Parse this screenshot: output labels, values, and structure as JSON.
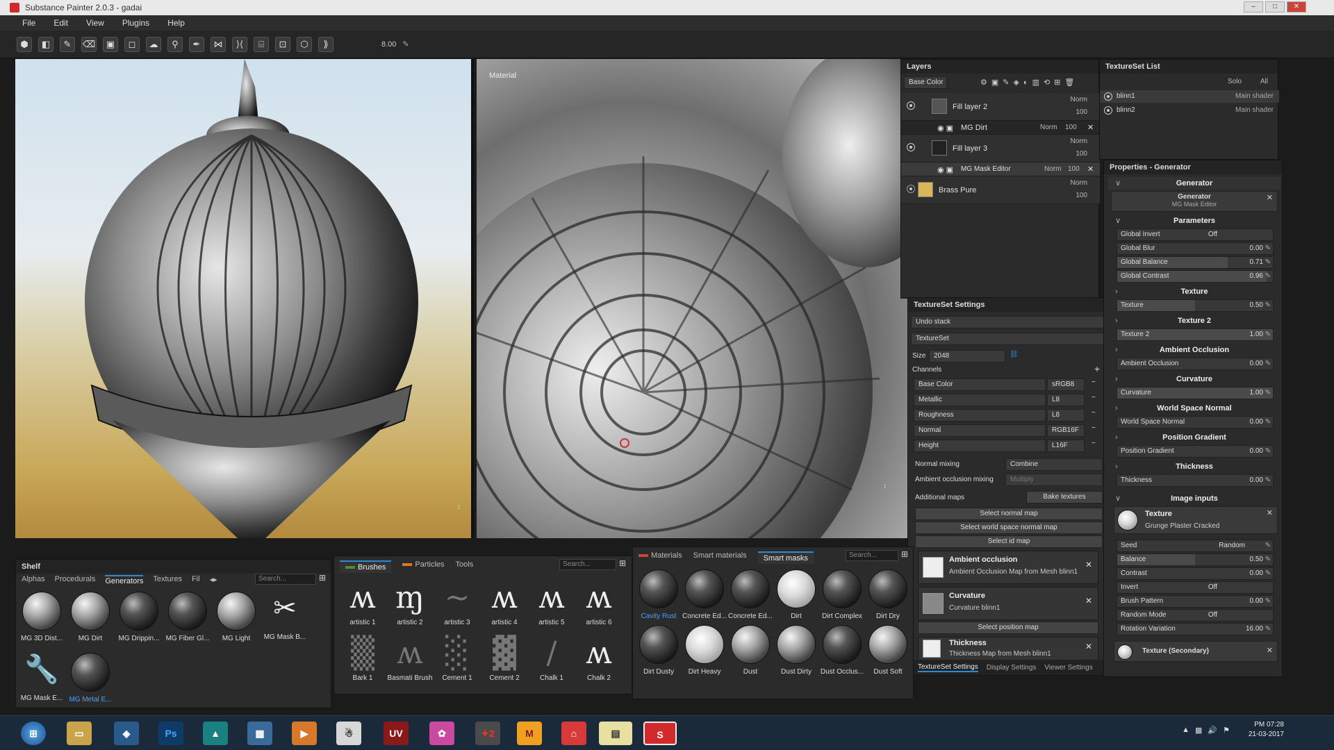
{
  "app": {
    "title": "Substance Painter 2.0.3 - gadai"
  },
  "menu": [
    "File",
    "Edit",
    "View",
    "Plugins",
    "Help"
  ],
  "toolbar": {
    "brush_size": "8.00"
  },
  "viewport2d": {
    "label": "Material"
  },
  "layers": {
    "title": "Layers",
    "channel": "Base Color",
    "items": [
      {
        "name": "Fill layer 2",
        "blend": "Norm",
        "opacity": "100"
      },
      {
        "name": "MG Dirt",
        "blend": "Norm",
        "opacity": "100"
      },
      {
        "name": "Fill layer 3",
        "blend": "Norm",
        "opacity": "100"
      },
      {
        "name": "MG Mask Editor",
        "blend": "Norm",
        "opacity": "100"
      },
      {
        "name": "Brass Pure",
        "blend": "Norm",
        "opacity": "100"
      }
    ]
  },
  "textureset_list": {
    "title": "TextureSet List",
    "solo": "Solo",
    "all": "All",
    "items": [
      {
        "name": "blinn1",
        "shader": "Main shader"
      },
      {
        "name": "blinn2",
        "shader": "Main shader"
      }
    ]
  },
  "textureset_settings": {
    "title": "TextureSet Settings",
    "undo_stack": "Undo stack",
    "textureset": "TextureSet",
    "size_label": "Size",
    "size_value": "2048",
    "channels_label": "Channels",
    "channels": [
      {
        "name": "Base Color",
        "format": "sRGB8"
      },
      {
        "name": "Metallic",
        "format": "L8"
      },
      {
        "name": "Roughness",
        "format": "L8"
      },
      {
        "name": "Normal",
        "format": "RGB16F"
      },
      {
        "name": "Height",
        "format": "L16F"
      }
    ],
    "normal_mixing_label": "Normal mixing",
    "normal_mixing_value": "Combine",
    "ao_mixing_label": "Ambient occlusion mixing",
    "ao_mixing_value": "Multiply",
    "additional_maps_label": "Additional maps",
    "bake_textures": "Bake textures",
    "select_normal_map": "Select normal map",
    "select_ws_normal_map": "Select world space normal map",
    "select_id_map": "Select id map",
    "maps": [
      {
        "title": "Ambient occlusion",
        "sub": "Ambient Occlusion Map from Mesh blinn1"
      },
      {
        "title": "Curvature",
        "sub": "Curvature blinn1"
      }
    ],
    "select_position_map": "Select position map",
    "thickness": {
      "title": "Thickness",
      "sub": "Thickness Map from Mesh blinn1"
    },
    "tabs": [
      "TextureSet Settings",
      "Display Settings",
      "Viewer Settings"
    ]
  },
  "properties": {
    "title": "Properties - Generator",
    "generator_header": "Generator",
    "generator_name": "Generator",
    "generator_sub": "MG Mask Editor",
    "parameters": "Parameters",
    "global_invert_label": "Global Invert",
    "global_invert_value": "Off",
    "sliders1": [
      {
        "label": "Global Blur",
        "value": "0.00"
      },
      {
        "label": "Global Balance",
        "value": "0.71"
      },
      {
        "label": "Global Contrast",
        "value": "0.96"
      }
    ],
    "sections": [
      {
        "title": "Texture",
        "label": "Texture",
        "value": "0.50"
      },
      {
        "title": "Texture 2",
        "label": "Texture 2",
        "value": "1.00"
      },
      {
        "title": "Ambient Occlusion",
        "label": "Ambient Occlusion",
        "value": "0.00"
      },
      {
        "title": "Curvature",
        "label": "Curvature",
        "value": "1.00"
      },
      {
        "title": "World Space Normal",
        "label": "World Space Normal",
        "value": "0.00"
      },
      {
        "title": "Position Gradient",
        "label": "Position Gradient",
        "value": "0.00"
      },
      {
        "title": "Thickness",
        "label": "Thickness",
        "value": "0.00"
      }
    ],
    "image_inputs": "Image inputs",
    "texture_input": {
      "title": "Texture",
      "sub": "Grunge Plaster Cracked"
    },
    "seed_label": "Seed",
    "seed_value": "Random",
    "sliders2": [
      {
        "label": "Balance",
        "value": "0.50"
      },
      {
        "label": "Contrast",
        "value": "0.00"
      }
    ],
    "invert_label": "Invert",
    "invert_value": "Off",
    "brush_pattern_label": "Brush Pattern",
    "brush_pattern_value": "0.00",
    "random_mode_label": "Random Mode",
    "random_mode_value": "Off",
    "rotation_label": "Rotation Variation",
    "rotation_value": "16.00",
    "texture_secondary": "Texture (Secondary)"
  },
  "shelf": {
    "title": "Shelf",
    "tabs": [
      "Alphas",
      "Procedurals",
      "Generators",
      "Textures",
      "Fil"
    ],
    "search_placeholder": "Search...",
    "items": [
      "MG 3D Dist...",
      "MG Dirt",
      "MG Drippin...",
      "MG Fiber Gl...",
      "MG Light",
      "MG Mask B...",
      "MG Mask E...",
      "MG Metal E..."
    ]
  },
  "brushes": {
    "tabs": [
      "Brushes",
      "Particles",
      "Tools"
    ],
    "search_placeholder": "Search...",
    "items": [
      "artistic 1",
      "artistic 2",
      "artistic 3",
      "artistic 4",
      "artistic 5",
      "artistic 6",
      "Bark 1",
      "Basmati Brush",
      "Cement 1",
      "Cement 2",
      "Chalk 1",
      "Chalk 2"
    ]
  },
  "materials": {
    "tabs": [
      "Materials",
      "Smart materials",
      "Smart masks"
    ],
    "search_placeholder": "Search...",
    "items": [
      "Cavity Rust",
      "Concrete Ed...",
      "Concrete Ed...",
      "Dirt",
      "Dirt Complex",
      "Dirt Dry",
      "Dirt Dusty",
      "Dirt Heavy",
      "Dust",
      "Dust Dirty",
      "Dust Occlus...",
      "Dust Soft"
    ]
  },
  "taskbar": {
    "time": "PM 07:28",
    "date": "21-03-2017",
    "icons": [
      "Ps",
      "UV",
      "M",
      "S"
    ]
  },
  "colors": {
    "accent": "#2a8cd8",
    "substance_red": "#d12a2a"
  }
}
